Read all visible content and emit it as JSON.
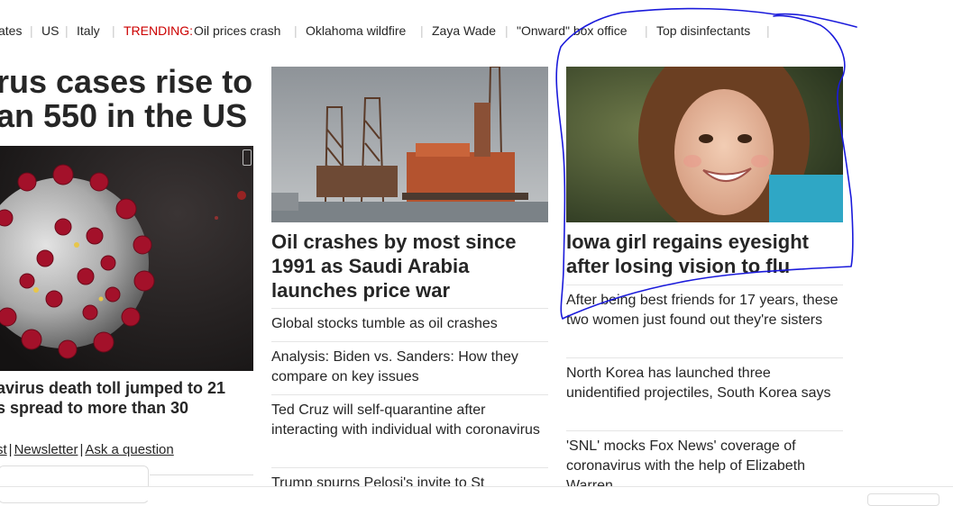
{
  "trending": {
    "items_before": [
      "ates",
      "US",
      "Italy"
    ],
    "label": "TRENDING:",
    "items_after": [
      "Oil prices crash",
      "Oklahoma wildfire",
      "Zaya Wade",
      "\"Onward\" box office",
      "Top disinfectants"
    ]
  },
  "left": {
    "headline_line1": "rus cases rise to",
    "headline_line2": "an 550 in the US",
    "caption_line1": "avirus death toll jumped to 21",
    "caption_line2": "s spread to more than 30",
    "links": [
      "st",
      "Newsletter",
      "Ask a question"
    ],
    "badge_icon": "cnn-badge-icon"
  },
  "middle": {
    "headline": "Oil crashes by most since 1991 as Saudi Arabia launches price war",
    "items": [
      "Global stocks tumble as oil crashes",
      "Analysis: Biden vs. Sanders: How they compare on key issues",
      "Ted Cruz will self-quarantine after interacting with individual with coronavirus",
      "Trump spurns Pelosi's invite to St"
    ]
  },
  "right": {
    "headline": "Iowa girl regains eyesight after losing vision to flu",
    "items": [
      "After being best friends for 17 years, these two women just found out they're sisters",
      "North Korea has launched three unidentified projectiles, South Korea says",
      "'SNL' mocks Fox News' coverage of coronavirus with the help of Elizabeth Warren"
    ]
  },
  "colors": {
    "trending_label": "#cc0000",
    "annotation_pen": "#1a1adb",
    "text": "#262626"
  }
}
